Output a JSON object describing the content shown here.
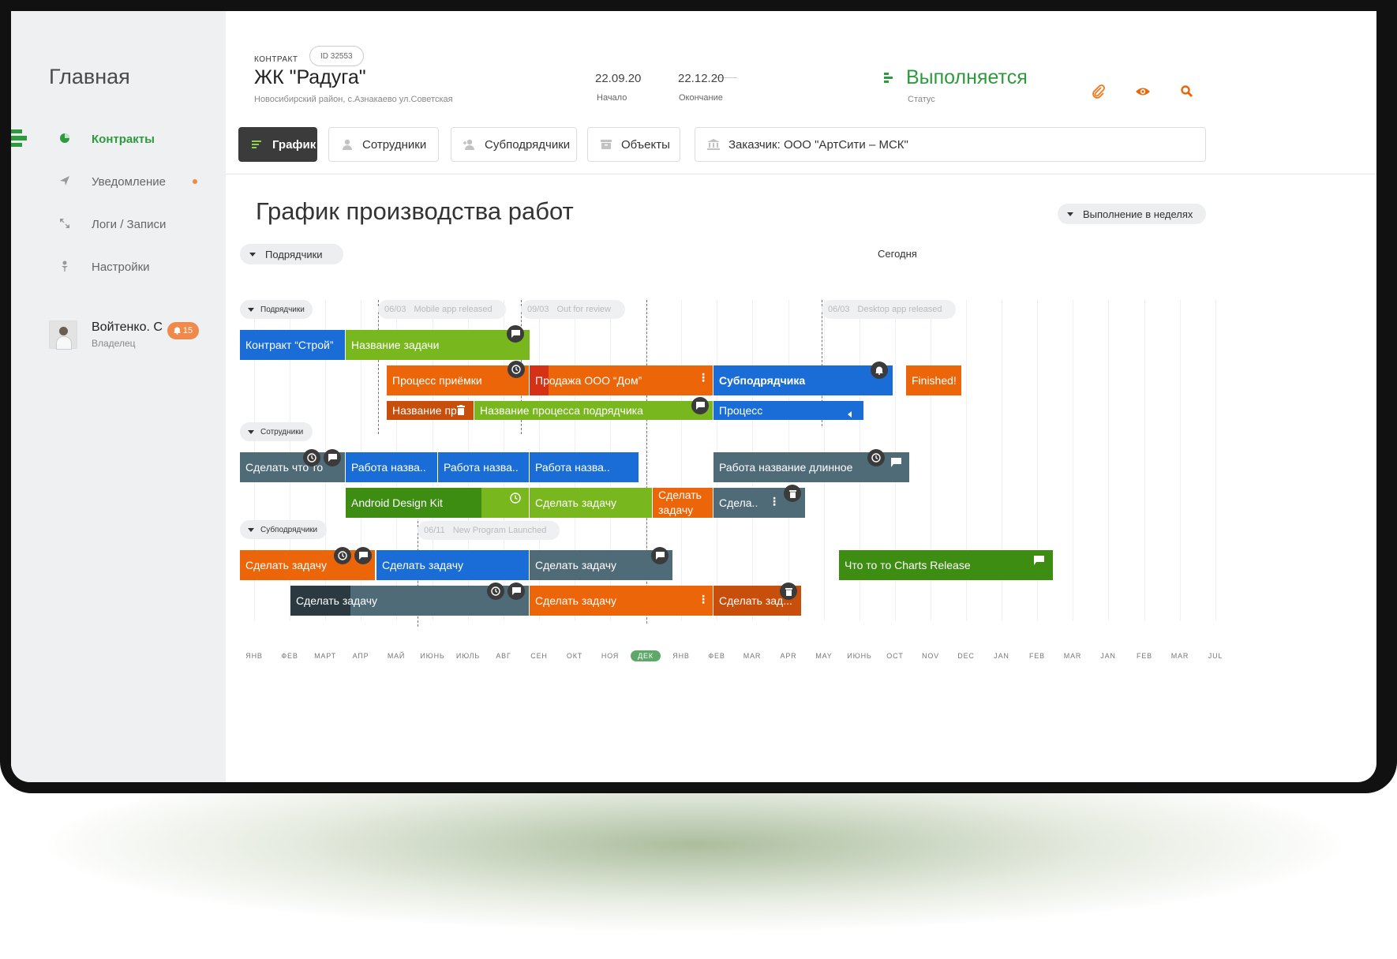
{
  "sidebar": {
    "title": "Главная",
    "items": [
      {
        "label": "Контракты",
        "icon": "pie-chart-icon",
        "active": true
      },
      {
        "label": "Уведомление",
        "icon": "send-icon",
        "has_dot": true
      },
      {
        "label": "Логи / Записи",
        "icon": "expand-arrows-icon"
      },
      {
        "label": "Настройки",
        "icon": "pin-icon"
      }
    ],
    "user": {
      "name": "Войтенко. С",
      "role": "Владелец",
      "badge": "15"
    }
  },
  "header": {
    "kind": "КОНТРАКТ",
    "id": "ID 32553",
    "title": "ЖК \"Радуга\"",
    "address": "Новосибирский район, с.Азнакаево ул.Советская",
    "start_date": "22.09.20",
    "start_label": "Начало",
    "end_date": "22.12.20",
    "end_label": "Окончание",
    "status": "Выполняется",
    "status_label": "Статус",
    "status_color": "#2e9a3e",
    "actions": [
      "paperclip-icon",
      "eye-icon",
      "search-icon"
    ]
  },
  "tabs": [
    {
      "label": "График",
      "icon": "gantt-icon",
      "active": true
    },
    {
      "label": "Сотрудники",
      "icon": "person-icon"
    },
    {
      "label": "Субподрядчики",
      "icon": "person-add-icon"
    },
    {
      "label": "Объекты",
      "icon": "archive-icon"
    },
    {
      "label": "Заказчик: ООО \"АртСити – МСК\"",
      "icon": "bank-icon"
    }
  ],
  "schedule": {
    "title": "График производства работ",
    "view_toggle": "Выполнение в неделях",
    "filter": "Подрядчики",
    "today_label": "Сегодня",
    "groups": [
      "Подрядчики",
      "Сотрудники",
      "Субподрядчики"
    ],
    "milestones": [
      {
        "date": "06/03",
        "label": "Mobile app released"
      },
      {
        "date": "09/03",
        "label": "Out for review"
      },
      {
        "date": "06/03",
        "label": "Desktop app released"
      },
      {
        "date": "06/11",
        "label": "New Program Launched"
      }
    ],
    "tasks": [
      "Контракт “Строй”",
      "Название задачи",
      "Процесс приёмки",
      "Продажа ООО “Дом”",
      "Субподрядчика",
      "Finished!",
      "Название пр",
      "Название процесса подрядчика",
      "Процесс",
      "Сделать что то",
      "Работа назва..",
      "Работа назва..",
      "Работа назва..",
      "Работа название длинное",
      "Android Design Kit",
      "Сделать задачу",
      "Сделать задачу",
      "Сдела..",
      "Сделать задачу",
      "Сделать задачу",
      "Сделать задачу",
      "Что то то Charts Release",
      "Сделать задачу",
      "Сделать задачу",
      "Сделать зад..."
    ],
    "months": [
      "ЯНВ",
      "ФЕВ",
      "МАРТ",
      "АПР",
      "МАЙ",
      "ИЮНЬ",
      "ИЮЛЬ",
      "АВГ",
      "СЕН",
      "ОКТ",
      "НОЯ",
      "ДЕК",
      "ЯНВ",
      "ФЕВ",
      "MAR",
      "APR",
      "MAY",
      "ИЮНЬ",
      "OCT",
      "NOV",
      "DEC",
      "JAN",
      "FEB",
      "MAR",
      "JAN",
      "FEB",
      "MAR",
      "JUL"
    ],
    "current_month_index": 11
  }
}
